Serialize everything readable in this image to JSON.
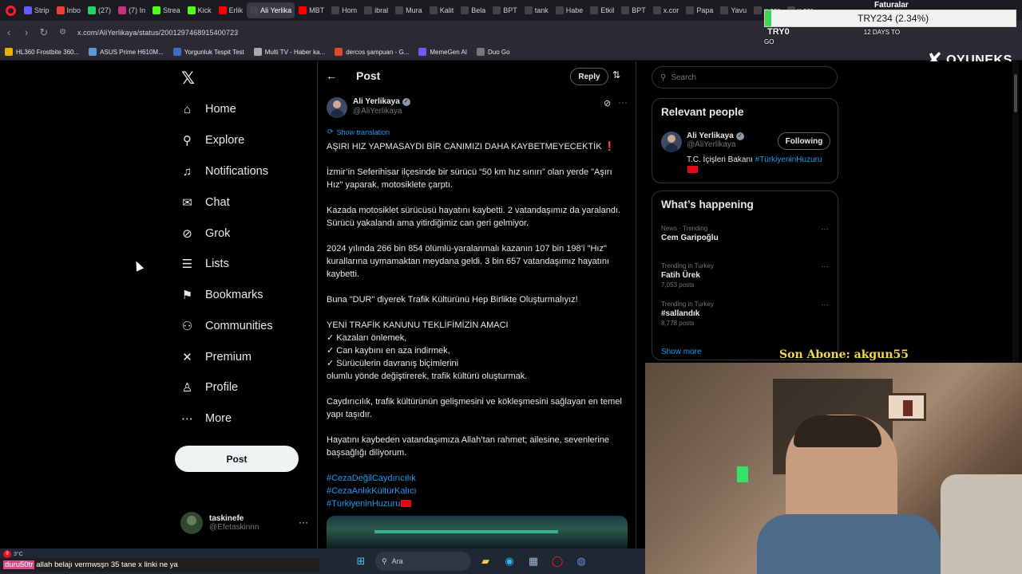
{
  "browser": {
    "tabs": [
      {
        "label": "Strip",
        "icon": "stripe-icon",
        "color": "#635bff"
      },
      {
        "label": "Inbo",
        "icon": "gmail-icon",
        "color": "#ea4335"
      },
      {
        "label": "(27)",
        "icon": "whatsapp-icon",
        "color": "#25d366"
      },
      {
        "label": "(7) In",
        "icon": "instagram-icon",
        "color": "#c13584"
      },
      {
        "label": "Strea",
        "icon": "kick-icon",
        "color": "#53fc18"
      },
      {
        "label": "Kick",
        "icon": "kick-icon",
        "color": "#53fc18"
      },
      {
        "label": "Erlik",
        "icon": "youtube-icon",
        "color": "#ff0000"
      },
      {
        "label": "Ali Yerlika",
        "icon": "x-icon",
        "color": "#444444"
      },
      {
        "label": "MBT",
        "icon": "youtube-icon",
        "color": "#ff0000"
      },
      {
        "label": "Hom",
        "icon": "x-icon",
        "color": "#444444"
      },
      {
        "label": "ibral",
        "icon": "x-icon",
        "color": "#444444"
      },
      {
        "label": "Mura",
        "icon": "x-icon",
        "color": "#444444"
      },
      {
        "label": "Kalit",
        "icon": "x-icon",
        "color": "#444444"
      },
      {
        "label": "Bela",
        "icon": "x-icon",
        "color": "#444444"
      },
      {
        "label": "BPT",
        "icon": "x-icon",
        "color": "#444444"
      },
      {
        "label": "tank",
        "icon": "x-icon",
        "color": "#444444"
      },
      {
        "label": "Habe",
        "icon": "x-icon",
        "color": "#444444"
      },
      {
        "label": "Etkil",
        "icon": "x-icon",
        "color": "#444444"
      },
      {
        "label": "BPT",
        "icon": "x-icon",
        "color": "#444444"
      },
      {
        "label": "x.cor",
        "icon": "x-icon",
        "color": "#444444"
      },
      {
        "label": "Papa",
        "icon": "x-icon",
        "color": "#444444"
      },
      {
        "label": "Yavu",
        "icon": "x-icon",
        "color": "#444444"
      },
      {
        "label": "x.cor",
        "icon": "x-icon",
        "color": "#444444"
      },
      {
        "label": "x.cor",
        "icon": "x-icon",
        "color": "#444444"
      }
    ],
    "url": "x.com/AliYerlikaya/status/2001297468915400723",
    "bookmarks": [
      {
        "label": "HL360 Frostbite 360...",
        "color": "#e5b400"
      },
      {
        "label": "ASUS Prime H610M...",
        "color": "#5b9bd5"
      },
      {
        "label": "Yorgunluk Tespit Test",
        "color": "#3d6fc7"
      },
      {
        "label": "Multi TV - Haber ka...",
        "color": "#aaaaaa"
      },
      {
        "label": "dercos şampuan - G...",
        "color": "#e04a2c"
      },
      {
        "label": "MemeGen AI",
        "color": "#6b5cff"
      },
      {
        "label": "Duo Go",
        "color": "#777777"
      }
    ]
  },
  "overlay": {
    "price": "TRY234 (2.34%)",
    "price_label": "TRY0",
    "price_label_right": "12 DAYS TO GO",
    "faturalar": "Faturalar",
    "sponsor": "OYUNEKS",
    "last_sub": "Son Abone: akgun55"
  },
  "x_nav": {
    "items": [
      {
        "label": "Home",
        "icon": "home-icon",
        "glyph": "⌂"
      },
      {
        "label": "Explore",
        "icon": "search-icon",
        "glyph": "⚲"
      },
      {
        "label": "Notifications",
        "icon": "bell-icon",
        "glyph": "♫"
      },
      {
        "label": "Chat",
        "icon": "mail-icon",
        "glyph": "✉"
      },
      {
        "label": "Grok",
        "icon": "grok-icon",
        "glyph": "⊘"
      },
      {
        "label": "Lists",
        "icon": "list-icon",
        "glyph": "☰"
      },
      {
        "label": "Bookmarks",
        "icon": "bookmark-icon",
        "glyph": "⚑"
      },
      {
        "label": "Communities",
        "icon": "communities-icon",
        "glyph": "⚇"
      },
      {
        "label": "Premium",
        "icon": "x-premium-icon",
        "glyph": "✕"
      },
      {
        "label": "Profile",
        "icon": "profile-icon",
        "glyph": "♙"
      },
      {
        "label": "More",
        "icon": "more-circle-icon",
        "glyph": "⋯"
      }
    ],
    "post_label": "Post",
    "account": {
      "name": "taskinefe",
      "handle": "@Efetaskinnn"
    }
  },
  "post": {
    "header_title": "Post",
    "reply_label": "Reply",
    "author": {
      "name": "Ali Yerlikaya",
      "handle": "@AliYerlikaya"
    },
    "show_translation": "Show translation",
    "headline": "AŞIRI HIZ YAPMASAYDI BİR CANIMIZI DAHA KAYBETMEYECEKTİK",
    "headline_mark": "❗",
    "paragraphs": [
      "İzmir’in Seferihisar ilçesinde bir sürücü “50 km hız sınırı” olan yerde \"Aşırı Hız\" yaparak, motosiklete çarptı.",
      "Kazada motosiklet sürücüsü hayatını kaybetti. 2 vatandaşımız da yaralandı. Sürücü yakalandı ama yitirdiğimiz can geri gelmiyor.",
      "2024 yılında 266 bin 854 ölümlü-yaralanmalı kazanın 107 bin 198’i \"Hız\" kurallarına uymamaktan meydana geldi. 3 bin 657 vatandaşımız hayatını kaybetti.",
      "Buna \"DUR\" diyerek Trafik Kültürünü Hep Birlikte Oluşturmalıyız!"
    ],
    "purpose_title": "YENİ TRAFİK KANUNU TEKLİFİMİZİN AMACI",
    "purpose_items": [
      "✓ Kazaları önlemek,",
      "✓ Can kaybını en aza indirmek,",
      "✓ Sürücülerin davranış biçimlerini",
      "olumlu yönde değiştirerek, trafik kültürü oluşturmak."
    ],
    "closing": [
      "Caydırıcılık, trafik kültürünün gelişmesini ve kökleşmesini sağlayan en temel yapı taşıdır.",
      "Hayatını kaybeden vatandaşımıza Allah’tan rahmet; ailesine, sevenlerine başsağlığı diliyorum."
    ],
    "hashtags": [
      "#CezaDeğilCaydırıcılık",
      "#CezaAnlıkKültürKalıcı",
      "#TürkiyeninHuzuru"
    ]
  },
  "sidebar": {
    "search_placeholder": "Search",
    "relevant_title": "Relevant people",
    "person": {
      "name": "Ali Yerlikaya",
      "handle": "@AliYerlikaya",
      "follow_label": "Following",
      "bio": "T.C. İçişleri Bakanı",
      "bio_tag": "#TürkiyeninHuzuru"
    },
    "happening_title": "What’s happening",
    "trends": [
      {
        "category": "News · Trending",
        "name": "Cem Garipoğlu",
        "count": ""
      },
      {
        "category": "Trending in Turkey",
        "name": "Fatih Ürek",
        "count": "7,053 posts"
      },
      {
        "category": "Trending in Turkey",
        "name": "#sallandık",
        "count": "8,778 posts"
      }
    ],
    "show_more": "Show more"
  },
  "taskbar": {
    "temp": "3°C",
    "badge": "9",
    "search_label": "Ara",
    "chat_user": "duru50tr",
    "chat_text": "allah belajı vermwsşn 35 tane x linki ne ya"
  },
  "colors": {
    "accent": "#1d9bf0",
    "background": "#000000",
    "text": "#e7e9ea",
    "muted": "#71767b",
    "border": "#2f3336"
  }
}
